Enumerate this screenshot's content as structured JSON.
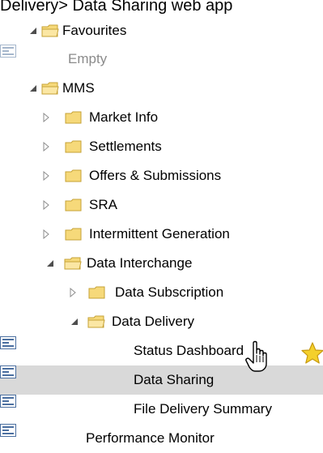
{
  "header": {
    "text": "Delivery> Data Sharing web app"
  },
  "tree": {
    "items": [
      {
        "label": "Favourites",
        "muted": false
      },
      {
        "label": "Empty",
        "muted": true
      },
      {
        "label": "MMS",
        "muted": false
      },
      {
        "label": "Market Info",
        "muted": false
      },
      {
        "label": "Settlements",
        "muted": false
      },
      {
        "label": "Offers & Submissions",
        "muted": false
      },
      {
        "label": "SRA",
        "muted": false
      },
      {
        "label": "Intermittent Generation",
        "muted": false
      },
      {
        "label": "Data Interchange",
        "muted": false
      },
      {
        "label": "Data Subscription",
        "muted": false
      },
      {
        "label": "Data Delivery",
        "muted": false
      },
      {
        "label": "Status Dashboard",
        "muted": false
      },
      {
        "label": "Data Sharing",
        "muted": false,
        "selected": true
      },
      {
        "label": "File Delivery Summary",
        "muted": false
      },
      {
        "label": "Performance Monitor",
        "muted": false
      }
    ]
  },
  "colors": {
    "folder": "#f6d97a",
    "folder_border": "#c6a235",
    "arrow": "#8c8c8c",
    "expanded_arrow": "#4e4e4e",
    "selected_bg": "#d9d9d9",
    "star": "#f4d02c"
  }
}
